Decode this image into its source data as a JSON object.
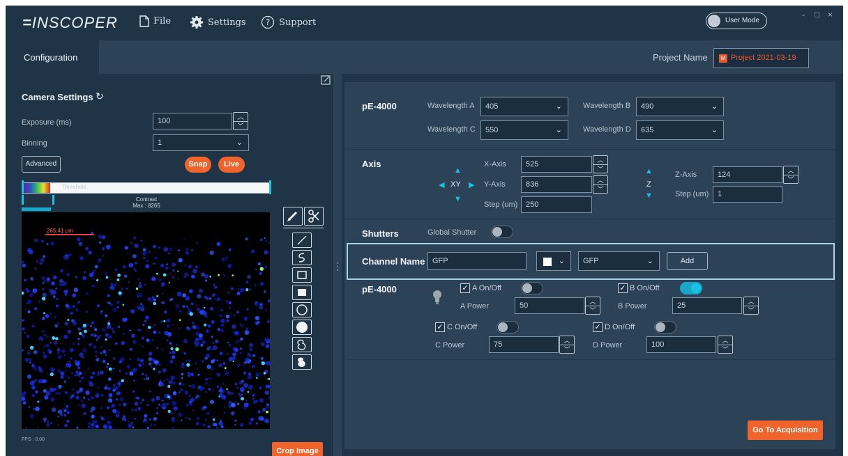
{
  "app": {
    "logo": "INSCOPER",
    "menu": {
      "file": "File",
      "settings": "Settings",
      "support": "Support"
    },
    "user_mode": "User Mode",
    "window_controls": {
      "minimize": "-",
      "maximize": "□",
      "close": "×"
    }
  },
  "config_bar": {
    "tab": "Configuration",
    "project_name_label": "Project Name",
    "project_name_value": "Project 2021-03-19",
    "project_icon_letter": "M"
  },
  "camera": {
    "title": "Camera Settings",
    "exposure_label": "Exposure (ms)",
    "exposure_value": "100",
    "binning_label": "Binning",
    "binning_value": "1",
    "advanced_button": "Advanced",
    "snap_button": "Snap",
    "live_button": "Live",
    "threshold_label": "Threshold",
    "contrast_label": "Contrast",
    "max_label": "Max : 8265",
    "scale_label": "265.41 µm",
    "fps_label": "FPS : 0.00",
    "crop_button": "Crop Image"
  },
  "pe4000_wavelengths": {
    "title": "pE-4000",
    "a_label": "Wavelength A",
    "a_value": "405",
    "b_label": "Wavelength B",
    "b_value": "490",
    "c_label": "Wavelength C",
    "c_value": "550",
    "d_label": "Wavelength D",
    "d_value": "635"
  },
  "axis": {
    "title": "Axis",
    "xy_label": "XY",
    "z_label": "Z",
    "x_label": "X-Axis",
    "x_value": "525",
    "y_label": "Y-Axis",
    "y_value": "836",
    "step_label": "Step (um)",
    "step_value": "250",
    "z_axis_label": "Z-Axis",
    "z_value": "124",
    "z_step_label": "Step (um)",
    "z_step_value": "1"
  },
  "shutters": {
    "title": "Shutters",
    "global_label": "Global Shutter"
  },
  "channel": {
    "title": "Channel Name",
    "name_value": "GFP",
    "preset_value": "GFP",
    "add_button": "Add"
  },
  "pe4000_channels": {
    "title": "pE-4000",
    "a_toggle": "A On/Off",
    "a_power_label": "A Power",
    "a_power": "50",
    "b_toggle": "B On/Off",
    "b_power_label": "B Power",
    "b_power": "25",
    "c_toggle": "C On/Off",
    "c_power_label": "C Power",
    "c_power": "75",
    "d_toggle": "D On/Off",
    "d_power_label": "D Power",
    "d_power": "100"
  },
  "go_button": "Go To Acquisition",
  "colors": {
    "accent_orange": "#f0642c",
    "accent_cyan": "#19c1e3",
    "background": "#1f3447",
    "panel": "#2b4257"
  }
}
